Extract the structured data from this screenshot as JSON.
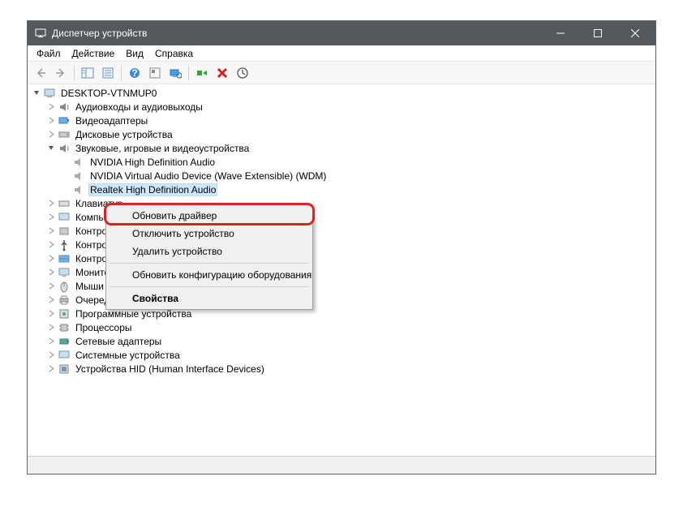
{
  "window": {
    "title": "Диспетчер устройств"
  },
  "menu": {
    "file": "Файл",
    "action": "Действие",
    "view": "Вид",
    "help": "Справка"
  },
  "tree": {
    "root": "DESKTOP-VTNMUP0",
    "cat_audio_io": "Аудиовходы и аудиовыходы",
    "cat_video": "Видеоадаптеры",
    "cat_disk": "Дисковые устройства",
    "cat_sound": "Звуковые, игровые и видеоустройства",
    "dev_nvidia_hda": "NVIDIA High Definition Audio",
    "dev_nvidia_virtual": "NVIDIA Virtual Audio Device (Wave Extensible) (WDM)",
    "dev_realtek": "Realtek High Definition Audio",
    "cat_keyboard": "Клавиатур",
    "cat_computer": "Компьюте",
    "cat_ctrl1": "Контролл",
    "cat_ctrl2": "Контролл",
    "cat_ctrl3": "Контролл",
    "cat_monitor": "Мониторы",
    "cat_mouse": "Мыши и и",
    "cat_printq": "Очереди печати",
    "cat_sw": "Программные устройства",
    "cat_cpu": "Процессоры",
    "cat_net": "Сетевые адаптеры",
    "cat_sys": "Системные устройства",
    "cat_hid": "Устройства HID (Human Interface Devices)"
  },
  "context": {
    "update": "Обновить драйвер",
    "disable": "Отключить устройство",
    "uninstall": "Удалить устройство",
    "scan": "Обновить конфигурацию оборудования",
    "properties": "Свойства"
  }
}
